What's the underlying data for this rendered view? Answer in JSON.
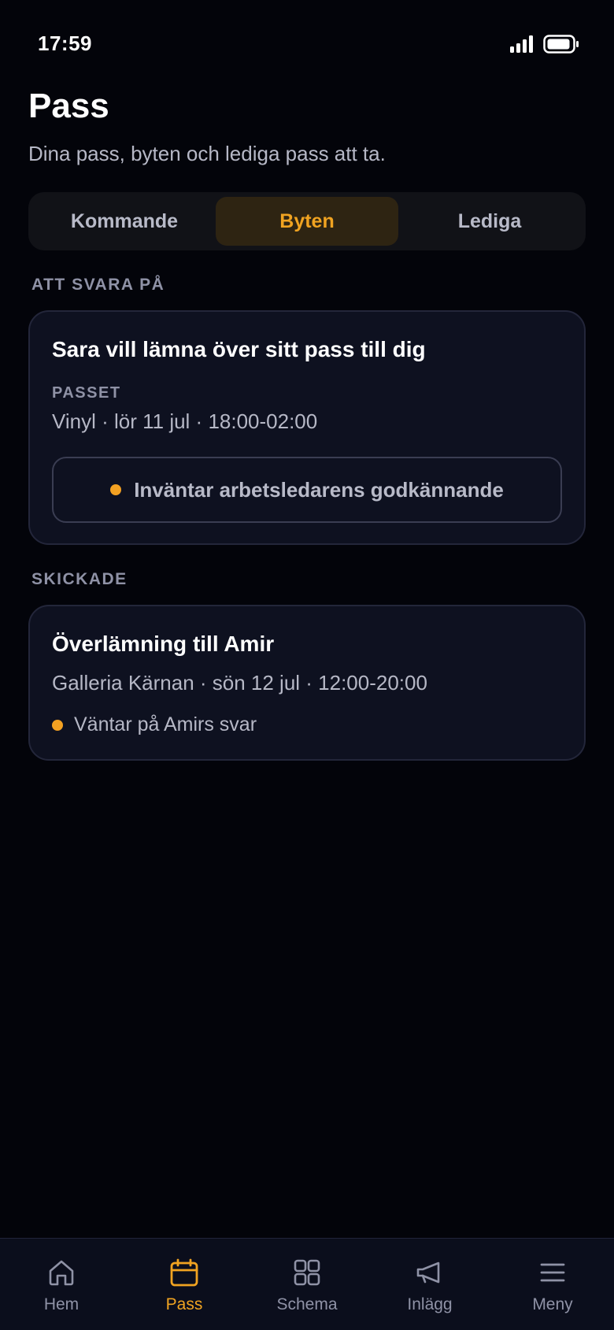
{
  "status_bar": {
    "time": "17:59"
  },
  "header": {
    "title": "Pass",
    "subtitle": "Dina pass, byten och lediga pass att ta."
  },
  "segments": [
    {
      "label": "Kommande",
      "active": false
    },
    {
      "label": "Byten",
      "active": true
    },
    {
      "label": "Lediga",
      "active": false
    }
  ],
  "to_answer": {
    "section_label": "ATT SVARA PÅ",
    "card": {
      "title": "Sara vill lämna över sitt pass till dig",
      "shift_label": "PASSET",
      "shift_info": "Vinyl · lör 11 jul · 18:00-02:00",
      "status": "Inväntar arbetsledarens godkännande"
    }
  },
  "sent": {
    "section_label": "SKICKADE",
    "card": {
      "title": "Överlämning till Amir",
      "shift_info": "Galleria Kärnan · sön 12 jul · 12:00-20:00",
      "status": "Väntar på Amirs svar"
    }
  },
  "tab_bar": [
    {
      "label": "Hem",
      "icon": "home-icon",
      "active": false
    },
    {
      "label": "Pass",
      "icon": "calendar-icon",
      "active": true
    },
    {
      "label": "Schema",
      "icon": "grid-icon",
      "active": false
    },
    {
      "label": "Inlägg",
      "icon": "megaphone-icon",
      "active": false
    },
    {
      "label": "Meny",
      "icon": "menu-icon",
      "active": false
    }
  ],
  "colors": {
    "accent": "#f0a321",
    "background": "#03040a",
    "card": "#0e1120",
    "status_dot": "#f3a122"
  }
}
